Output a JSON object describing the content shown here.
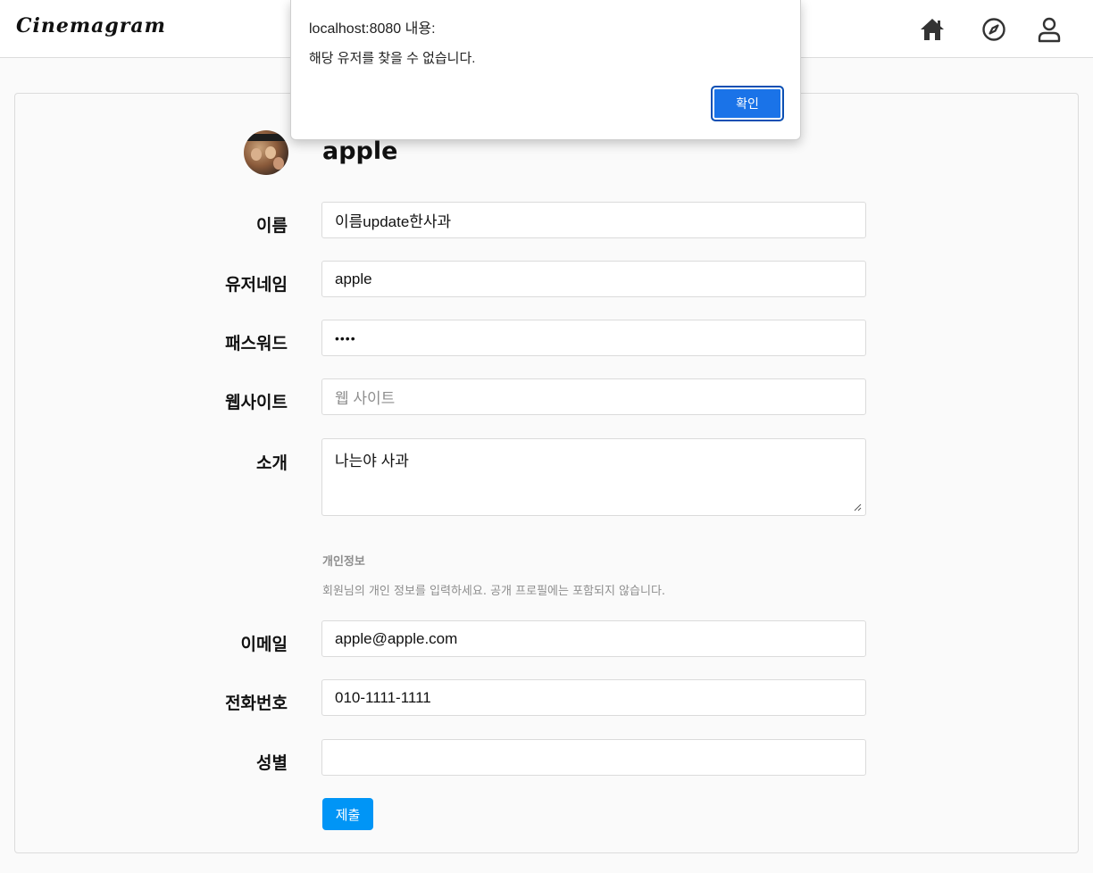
{
  "header": {
    "logo": "Cinemagram",
    "icons": [
      "home-icon",
      "compass-icon",
      "user-icon"
    ]
  },
  "profile": {
    "username_title": "apple"
  },
  "form": {
    "fields": [
      {
        "label": "이름",
        "value": "이름update한사과"
      },
      {
        "label": "유저네임",
        "value": "apple"
      },
      {
        "label": "패스워드",
        "value": "••••"
      },
      {
        "label": "웹사이트",
        "value": "",
        "placeholder": "웹 사이트"
      },
      {
        "label": "소개",
        "value": "나는야 사과"
      },
      {
        "label": "이메일",
        "value": "apple@apple.com"
      },
      {
        "label": "전화번호",
        "value": "010-1111-1111"
      },
      {
        "label": "성별",
        "value": ""
      }
    ],
    "private_section": {
      "title": "개인정보",
      "description": "회원님의 개인 정보를 입력하세요. 공개 프로필에는 포함되지 않습니다."
    },
    "submit_label": "제출"
  },
  "dialog": {
    "title": "localhost:8080 내용:",
    "message": "해당 유저를 찾을 수 없습니다.",
    "ok_label": "확인",
    "ok_color": "#1a73e8"
  },
  "colors": {
    "submit": "#0095f6",
    "border": "#dbdbdb",
    "muted_text": "#8e8e8e"
  }
}
